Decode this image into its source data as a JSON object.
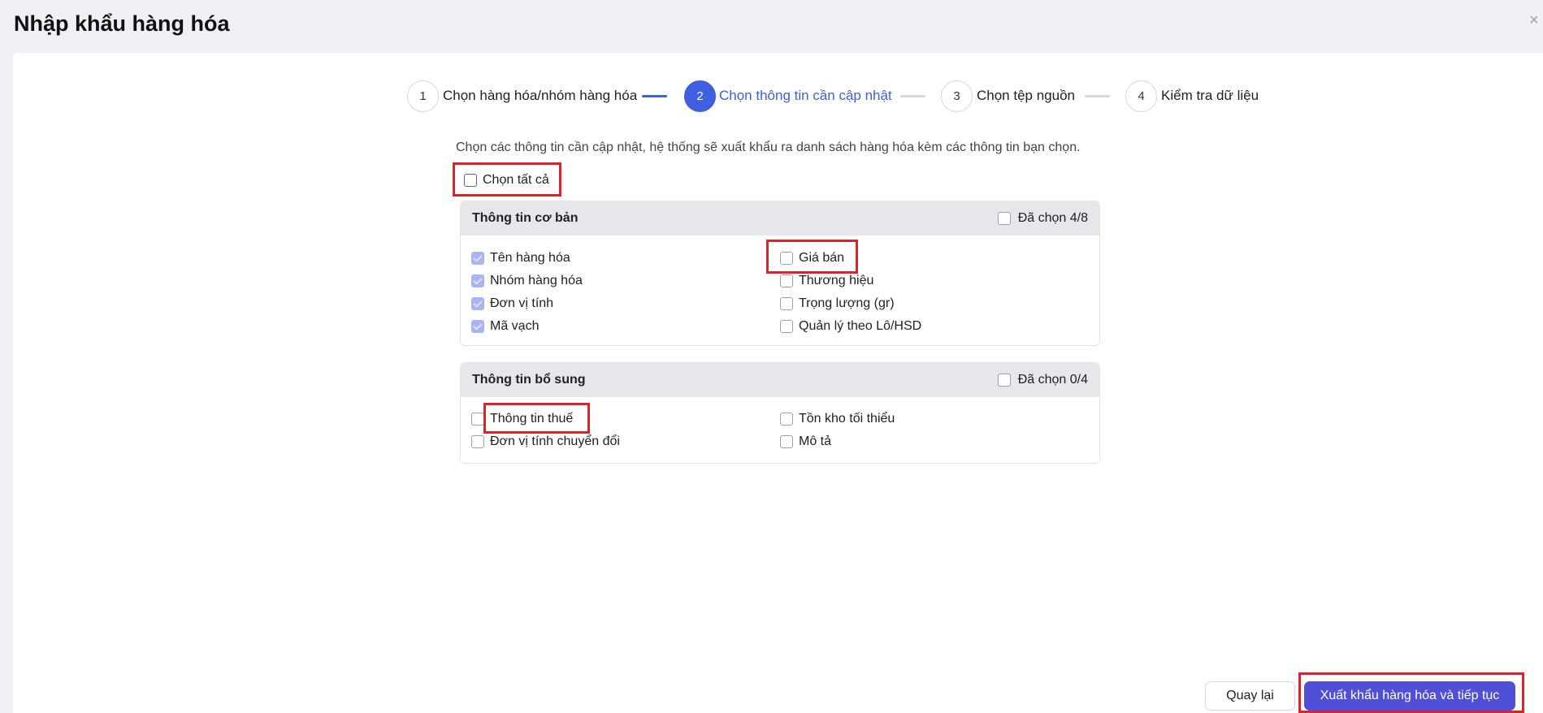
{
  "header": {
    "title": "Nhập khẩu hàng hóa",
    "close_icon": "×"
  },
  "steps": [
    {
      "number": "1",
      "label": "Chọn hàng hóa/nhóm hàng hóa",
      "state": "done"
    },
    {
      "number": "2",
      "label": "Chọn thông tin cần cập nhật",
      "state": "active"
    },
    {
      "number": "3",
      "label": "Chọn tệp nguồn",
      "state": "pending"
    },
    {
      "number": "4",
      "label": "Kiểm tra dữ liệu",
      "state": "pending"
    }
  ],
  "description": "Chọn các thông tin cần cập nhật, hệ thống sẽ xuất khẩu ra danh sách hàng hóa kèm các thông tin bạn chọn.",
  "select_all": {
    "label": "Chọn tất cả",
    "checked": false
  },
  "groups": [
    {
      "title": "Thông tin cơ bản",
      "count": "Đã chọn 4/8",
      "left": [
        {
          "label": "Tên hàng hóa",
          "checked": true
        },
        {
          "label": "Nhóm hàng hóa",
          "checked": true
        },
        {
          "label": "Đơn vị tính",
          "checked": true
        },
        {
          "label": "Mã vạch",
          "checked": true
        }
      ],
      "right": [
        {
          "label": "Giá bán",
          "checked": false
        },
        {
          "label": "Thương hiệu",
          "checked": false
        },
        {
          "label": "Trọng lượng (gr)",
          "checked": false
        },
        {
          "label": "Quản lý theo Lô/HSD",
          "checked": false
        }
      ]
    },
    {
      "title": "Thông tin bổ sung",
      "count": "Đã chọn 0/4",
      "left": [
        {
          "label": "Thông tin thuế",
          "checked": false
        },
        {
          "label": "Đơn vị tính chuyển đổi",
          "checked": false
        }
      ],
      "right": [
        {
          "label": "Tồn kho tối thiểu",
          "checked": false
        },
        {
          "label": "Mô tả",
          "checked": false
        }
      ]
    }
  ],
  "buttons": {
    "back": "Quay lại",
    "primary": "Xuất khẩu hàng hóa và tiếp tục"
  },
  "colors": {
    "accent": "#3d5fe0",
    "primary_button": "#4f4fd8",
    "highlight": "#e0202a"
  }
}
